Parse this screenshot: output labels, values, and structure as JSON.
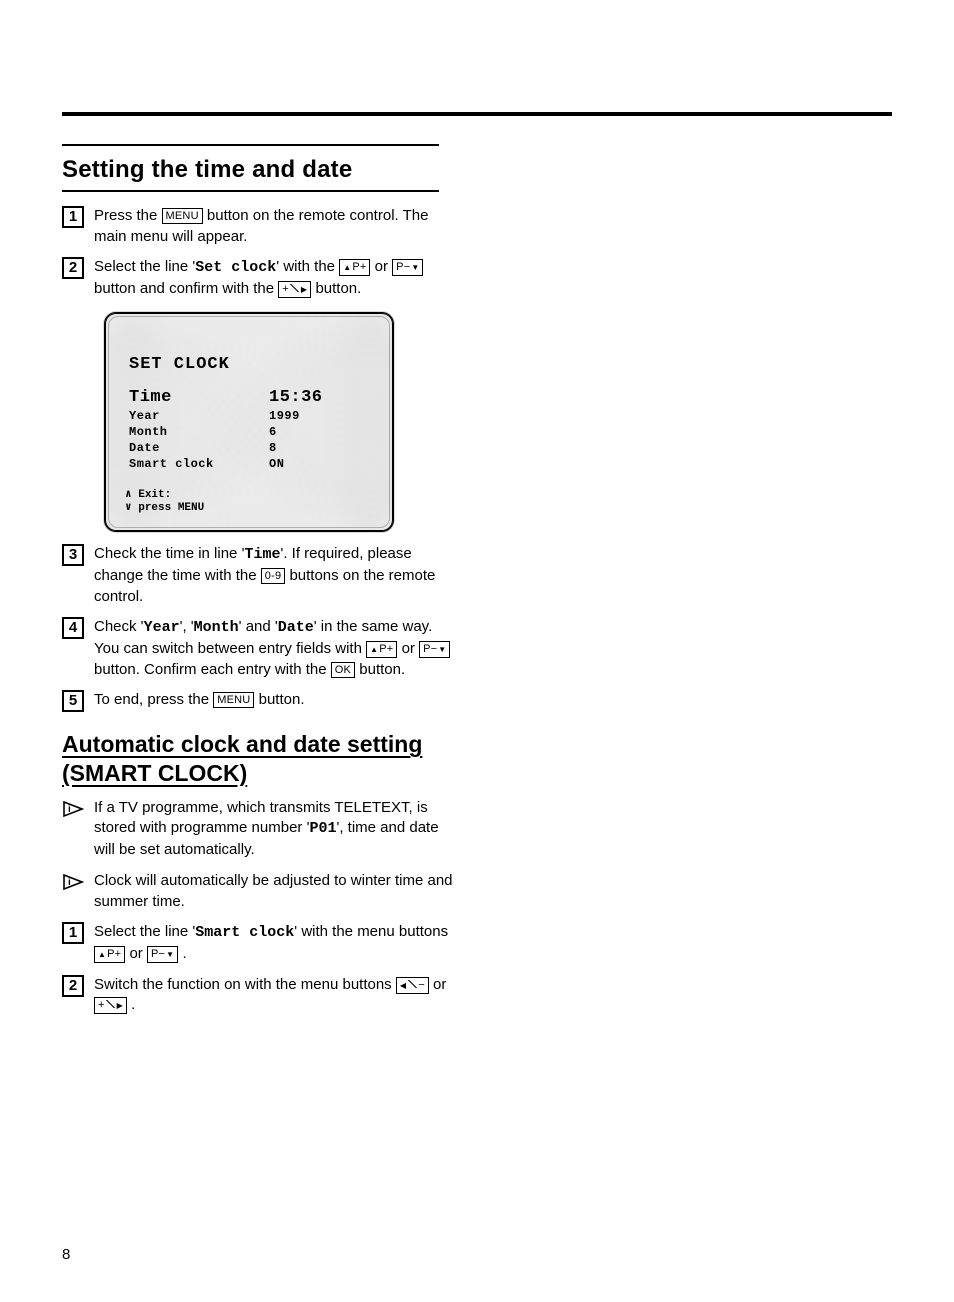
{
  "page_number": "8",
  "section1": {
    "title": "Setting the time and date",
    "steps": {
      "s1": {
        "num": "1",
        "pre": "Press the ",
        "btn_menu": "MENU",
        "post": " button on the remote control. The main menu will appear."
      },
      "s2": {
        "num": "2",
        "pre": "Select the line '",
        "mono": "Set clock",
        "mid1": "' with the ",
        "btn_up": "▲P+",
        "or": " or ",
        "btn_down": "P−▼",
        "mid2": " button and confirm with the ",
        "btn_right": "+◿▶",
        "post": " button."
      },
      "s3": {
        "num": "3",
        "pre": "Check the time in line '",
        "mono": "Time",
        "mid1": "'. If required, please change the time with the ",
        "btn_09": "0-9",
        "post": " buttons on the remote control."
      },
      "s4": {
        "num": "4",
        "pre": "Check '",
        "m1": "Year",
        "c1": "', '",
        "m2": "Month",
        "c2": "' and '",
        "m3": "Date",
        "mid1": "' in the same way. You can switch between entry fields with ",
        "btn_up": "▲P+",
        "or": " or ",
        "btn_down": "P−▼",
        "mid2": " button. Confirm each entry with the ",
        "btn_ok": "OK",
        "post": " button."
      },
      "s5": {
        "num": "5",
        "pre": "To end, press the ",
        "btn_menu": "MENU",
        "post": " button."
      }
    }
  },
  "screen": {
    "title": "SET CLOCK",
    "rows": [
      {
        "label": "Time",
        "value": "15:36",
        "size": "lg"
      },
      {
        "label": "Year",
        "value": "1999",
        "size": "sm"
      },
      {
        "label": "Month",
        "value": "6",
        "size": "sm"
      },
      {
        "label": "Date",
        "value": "8",
        "size": "sm"
      },
      {
        "label": "Smart clock",
        "value": "ON",
        "size": "sm"
      }
    ],
    "footer1": "∧ Exit:",
    "footer2": "∨ press MENU"
  },
  "section2": {
    "title": "Automatic clock and date setting (SMART CLOCK)",
    "info1": {
      "pre": "If a TV programme, which transmits TELETEXT, is stored with programme number '",
      "mono": "P01",
      "post": "', time and date will be set automatically."
    },
    "info2": {
      "text": "Clock will automatically be adjusted to winter time and summer time."
    },
    "steps": {
      "s1": {
        "num": "1",
        "pre": "Select the line '",
        "mono": "Smart clock",
        "mid1": "' with the menu buttons ",
        "btn_up": "▲P+",
        "or": " or ",
        "btn_down": "P−▼",
        "post": " ."
      },
      "s2": {
        "num": "2",
        "pre": "Switch the function on with the menu buttons ",
        "btn_left": "◀◿−",
        "or": " or ",
        "btn_right": "+◿▶",
        "post": " ."
      }
    }
  }
}
